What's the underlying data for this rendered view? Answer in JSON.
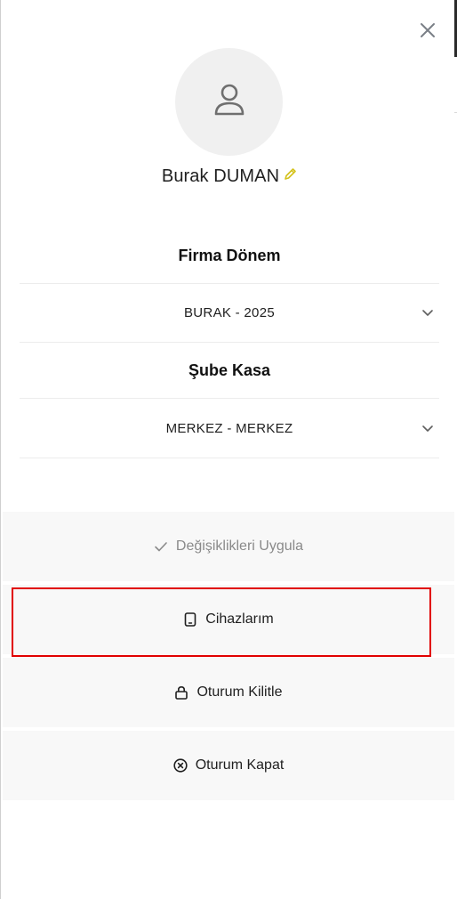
{
  "user": {
    "name": "Burak DUMAN"
  },
  "firma_donem": {
    "title": "Firma Dönem",
    "value": "BURAK - 2025"
  },
  "sube_kasa": {
    "title": "Şube Kasa",
    "value": "MERKEZ - MERKEZ"
  },
  "actions": {
    "apply_label": "Değişiklikleri Uygula",
    "devices_label": "Cihazlarım",
    "lock_label": "Oturum Kilitle",
    "logout_label": "Oturum Kapat"
  },
  "icons": {
    "close": "close-icon",
    "avatar": "user-icon",
    "edit": "pencil-icon",
    "chevron": "chevron-down-icon",
    "apply": "check-icon",
    "devices": "tablet-icon",
    "lock": "lock-icon",
    "logout": "x-circle-icon"
  },
  "colors": {
    "edit_icon": "#d4c21a",
    "highlight_border": "#e10000",
    "disabled_text": "#8a8a8a",
    "button_bg": "#f8f8f8"
  }
}
